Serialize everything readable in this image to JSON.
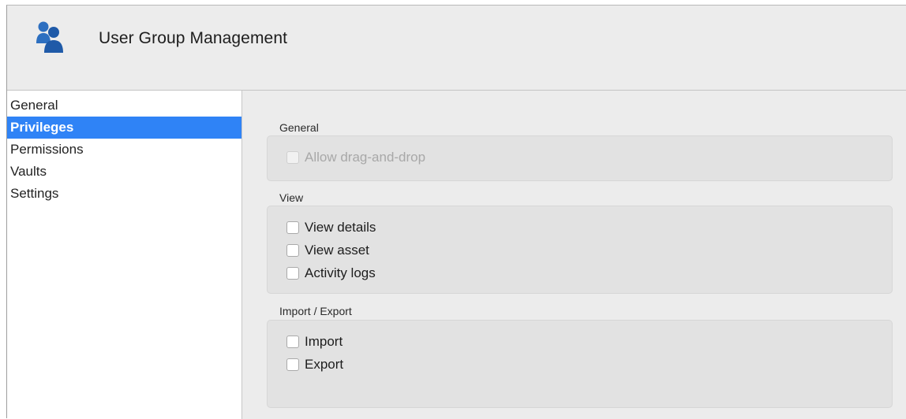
{
  "header": {
    "title": "User Group Management",
    "icon": "user-group-icon",
    "icon_color": "#2d6fc0"
  },
  "sidebar": {
    "items": [
      {
        "label": "General",
        "selected": false
      },
      {
        "label": "Privileges",
        "selected": true
      },
      {
        "label": "Permissions",
        "selected": false
      },
      {
        "label": "Vaults",
        "selected": false
      },
      {
        "label": "Settings",
        "selected": false
      }
    ],
    "selection_color": "#2f83f6"
  },
  "main": {
    "sections": [
      {
        "label": "General",
        "options": [
          {
            "label": "Allow drag-and-drop",
            "checked": false,
            "enabled": false
          }
        ]
      },
      {
        "label": "View",
        "options": [
          {
            "label": "View details",
            "checked": false,
            "enabled": true
          },
          {
            "label": "View asset",
            "checked": false,
            "enabled": true
          },
          {
            "label": "Activity logs",
            "checked": false,
            "enabled": true
          }
        ]
      },
      {
        "label": "Import / Export",
        "options": [
          {
            "label": "Import",
            "checked": false,
            "enabled": true
          },
          {
            "label": "Export",
            "checked": false,
            "enabled": true
          }
        ]
      }
    ]
  }
}
